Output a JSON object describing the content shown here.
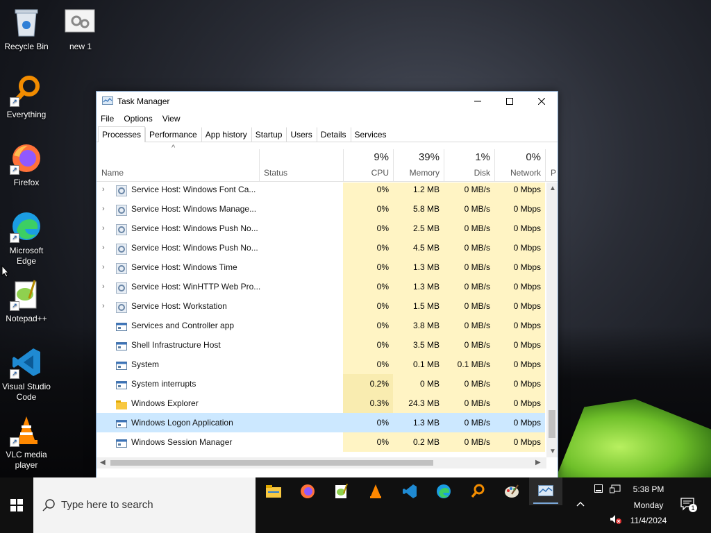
{
  "desktop": {
    "icons": [
      {
        "label": "Recycle Bin"
      },
      {
        "label": "new 1"
      },
      {
        "label": "Everything"
      },
      {
        "label": "Firefox"
      },
      {
        "label": "Microsoft Edge"
      },
      {
        "label": "Notepad++"
      },
      {
        "label": "Visual Studio Code"
      },
      {
        "label": "VLC media player"
      }
    ]
  },
  "window": {
    "title": "Task Manager",
    "menu": [
      "File",
      "Options",
      "View"
    ],
    "tabs": [
      "Processes",
      "Performance",
      "App history",
      "Startup",
      "Users",
      "Details",
      "Services"
    ],
    "active_tab": "Processes",
    "columns": {
      "name": "Name",
      "status": "Status",
      "cpu": {
        "pct": "9%",
        "label": "CPU"
      },
      "memory": {
        "pct": "39%",
        "label": "Memory"
      },
      "disk": {
        "pct": "1%",
        "label": "Disk"
      },
      "network": {
        "pct": "0%",
        "label": "Network"
      },
      "power": {
        "label": "P"
      }
    },
    "rows": [
      {
        "name": "Service Host: Windows Font Ca...",
        "cpu": "0%",
        "memory": "1.2 MB",
        "disk": "0 MB/s",
        "network": "0 Mbps",
        "expandable": true,
        "icon": "gear-icon"
      },
      {
        "name": "Service Host: Windows Manage...",
        "cpu": "0%",
        "memory": "5.8 MB",
        "disk": "0 MB/s",
        "network": "0 Mbps",
        "expandable": true,
        "icon": "gear-icon"
      },
      {
        "name": "Service Host: Windows Push No...",
        "cpu": "0%",
        "memory": "2.5 MB",
        "disk": "0 MB/s",
        "network": "0 Mbps",
        "expandable": true,
        "icon": "gear-icon"
      },
      {
        "name": "Service Host: Windows Push No...",
        "cpu": "0%",
        "memory": "4.5 MB",
        "disk": "0 MB/s",
        "network": "0 Mbps",
        "expandable": true,
        "icon": "gear-icon"
      },
      {
        "name": "Service Host: Windows Time",
        "cpu": "0%",
        "memory": "1.3 MB",
        "disk": "0 MB/s",
        "network": "0 Mbps",
        "expandable": true,
        "icon": "gear-icon"
      },
      {
        "name": "Service Host: WinHTTP Web Pro...",
        "cpu": "0%",
        "memory": "1.3 MB",
        "disk": "0 MB/s",
        "network": "0 Mbps",
        "expandable": true,
        "icon": "gear-icon"
      },
      {
        "name": "Service Host: Workstation",
        "cpu": "0%",
        "memory": "1.5 MB",
        "disk": "0 MB/s",
        "network": "0 Mbps",
        "expandable": true,
        "icon": "gear-icon"
      },
      {
        "name": "Services and Controller app",
        "cpu": "0%",
        "memory": "3.8 MB",
        "disk": "0 MB/s",
        "network": "0 Mbps",
        "expandable": false,
        "icon": "window-icon"
      },
      {
        "name": "Shell Infrastructure Host",
        "cpu": "0%",
        "memory": "3.5 MB",
        "disk": "0 MB/s",
        "network": "0 Mbps",
        "expandable": false,
        "icon": "window-icon"
      },
      {
        "name": "System",
        "cpu": "0%",
        "memory": "0.1 MB",
        "disk": "0.1 MB/s",
        "network": "0 Mbps",
        "expandable": false,
        "icon": "window-icon"
      },
      {
        "name": "System interrupts",
        "cpu": "0.2%",
        "memory": "0 MB",
        "disk": "0 MB/s",
        "network": "0 Mbps",
        "expandable": false,
        "icon": "window-icon"
      },
      {
        "name": "Windows Explorer",
        "cpu": "0.3%",
        "memory": "24.3 MB",
        "disk": "0 MB/s",
        "network": "0 Mbps",
        "expandable": false,
        "icon": "folder-icon"
      },
      {
        "name": "Windows Logon Application",
        "cpu": "0%",
        "memory": "1.3 MB",
        "disk": "0 MB/s",
        "network": "0 Mbps",
        "expandable": false,
        "icon": "window-icon",
        "selected": true
      },
      {
        "name": "Windows Session Manager",
        "cpu": "0%",
        "memory": "0.2 MB",
        "disk": "0 MB/s",
        "network": "0 Mbps",
        "expandable": false,
        "icon": "window-icon"
      }
    ]
  },
  "taskbar": {
    "search_placeholder": "Type here to search",
    "apps": [
      "file-explorer-icon",
      "firefox-icon",
      "notepadpp-icon",
      "vlc-icon",
      "vscode-icon",
      "edge-icon",
      "everything-icon",
      "paint-icon",
      "task-manager-icon"
    ],
    "clock": {
      "time": "5:38 PM",
      "day": "Monday",
      "date": "11/4/2024"
    },
    "notification_count": "1"
  }
}
